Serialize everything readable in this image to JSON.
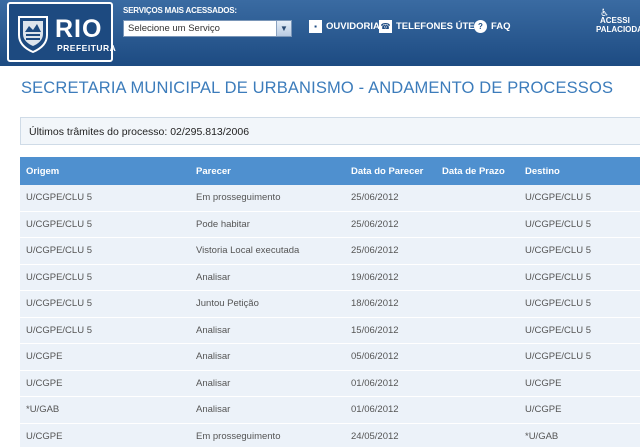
{
  "header": {
    "logo_title": "RIO",
    "logo_subtitle": "PREFEITURA",
    "services_label": "SERVIÇOS MAIS ACESSADOS:",
    "services_select_value": "Selecione um Serviço",
    "nav": [
      {
        "label": "OUVIDORIA",
        "icon": "ouvidoria-icon"
      },
      {
        "label": "TELEFONES ÚTEIS",
        "icon": "phone-icon"
      },
      {
        "label": "FAQ",
        "icon": "faq-icon"
      }
    ],
    "access_line1": "ACESSI",
    "access_line2": "PALACIODAC"
  },
  "page": {
    "title": "SECRETARIA MUNICIPAL DE URBANISMO - ANDAMENTO DE PROCESSOS",
    "process_info": "Últimos trâmites do processo: 02/295.813/2006"
  },
  "table": {
    "columns": [
      "Origem",
      "Parecer",
      "Data do Parecer",
      "Data de Prazo",
      "Destino"
    ],
    "rows": [
      [
        "U/CGPE/CLU 5",
        "Em prosseguimento",
        "25/06/2012",
        "",
        "U/CGPE/CLU 5"
      ],
      [
        "U/CGPE/CLU 5",
        "Pode habitar",
        "25/06/2012",
        "",
        "U/CGPE/CLU 5"
      ],
      [
        "U/CGPE/CLU 5",
        "Vistoria Local executada",
        "25/06/2012",
        "",
        "U/CGPE/CLU 5"
      ],
      [
        "U/CGPE/CLU 5",
        "Analisar",
        "19/06/2012",
        "",
        "U/CGPE/CLU 5"
      ],
      [
        "U/CGPE/CLU 5",
        "Juntou Petição",
        "18/06/2012",
        "",
        "U/CGPE/CLU 5"
      ],
      [
        "U/CGPE/CLU 5",
        "Analisar",
        "15/06/2012",
        "",
        "U/CGPE/CLU 5"
      ],
      [
        "U/CGPE",
        "Analisar",
        "05/06/2012",
        "",
        "U/CGPE/CLU 5"
      ],
      [
        "U/CGPE",
        "Analisar",
        "01/06/2012",
        "",
        "U/CGPE"
      ],
      [
        "*U/GAB",
        "Analisar",
        "01/06/2012",
        "",
        "U/CGPE"
      ],
      [
        "U/CGPE",
        "Em prosseguimento",
        "24/05/2012",
        "",
        "*U/GAB"
      ]
    ]
  },
  "colors": {
    "header_bg": "#1d4b82",
    "title_blue": "#3c7cbb",
    "table_header": "#4f90cf",
    "row_bg": "#ecf2f9"
  }
}
